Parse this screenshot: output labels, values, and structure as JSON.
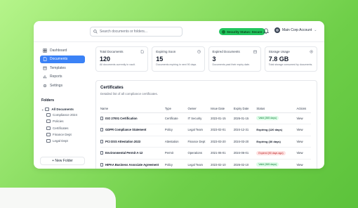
{
  "search": {
    "placeholder": "Search documents or folders..."
  },
  "header": {
    "status_label": "Security Status: Secure",
    "user_name": "Main Corp Account"
  },
  "sidebar": {
    "items": [
      {
        "label": "Dashboard",
        "icon": "grid-icon",
        "active": false
      },
      {
        "label": "Documents",
        "icon": "document-icon",
        "active": true
      },
      {
        "label": "Templates",
        "icon": "template-icon",
        "active": false
      },
      {
        "label": "Reports",
        "icon": "chart-icon",
        "active": false
      },
      {
        "label": "Settings",
        "icon": "gear-icon",
        "active": false
      }
    ],
    "folders_title": "Folders",
    "folder_root": "All Documents",
    "folders": [
      "Compliance 2024",
      "Policies",
      "Certificates",
      "Finance Dept",
      "Legal Dept"
    ],
    "new_folder_label": "+ New Folder"
  },
  "cards": [
    {
      "title": "Total Documents",
      "value": "120",
      "sub": "All documents currently in vault."
    },
    {
      "title": "Expiring Soon",
      "value": "15",
      "sub": "Documents expiring in next 90 days."
    },
    {
      "title": "Expired Documents",
      "value": "3",
      "sub": "Documents past their expiry date."
    },
    {
      "title": "Storage Usage",
      "value": "7.8 GB",
      "sub": "Total storage consumed by documents."
    }
  ],
  "certificates": {
    "title": "Certificates",
    "subtitle": "Detailed list of all compliance certificates.",
    "columns": [
      "Name",
      "Type",
      "Owner",
      "Issue Date",
      "Expiry Date",
      "Status",
      "Actions"
    ],
    "rows": [
      {
        "name": "ISO 27001 Certification",
        "type": "Certificate",
        "owner": "IT Security",
        "issue": "2023-01-15",
        "expiry": "2026-01-15",
        "status": "Valid (365 days)",
        "status_kind": "valid",
        "action": "View"
      },
      {
        "name": "GDPR Compliance Statement",
        "type": "Policy",
        "owner": "Legal Team",
        "issue": "2023-02-01",
        "expiry": "2024-12-31",
        "status": "Expiring (120 days)",
        "status_kind": "expiring",
        "action": "View"
      },
      {
        "name": "PCI DSS Attestation 2023",
        "type": "Attestation",
        "owner": "Finance Dept",
        "issue": "2023-03-20",
        "expiry": "2024-03-20",
        "status": "Expiring (30 days)",
        "status_kind": "expiring",
        "action": "View"
      },
      {
        "name": "Environmental Permit A-12",
        "type": "Permit",
        "owner": "Operations",
        "issue": "2021-06-01",
        "expiry": "2024-06-01",
        "status": "Expired (90 days ago)",
        "status_kind": "expired",
        "action": "View"
      },
      {
        "name": "HIPAA Business Associate Agreement",
        "type": "Policy",
        "owner": "Legal Team",
        "issue": "2023-02-10",
        "expiry": "2026-02-10",
        "status": "Valid (365 days)",
        "status_kind": "valid",
        "action": "View"
      }
    ]
  }
}
